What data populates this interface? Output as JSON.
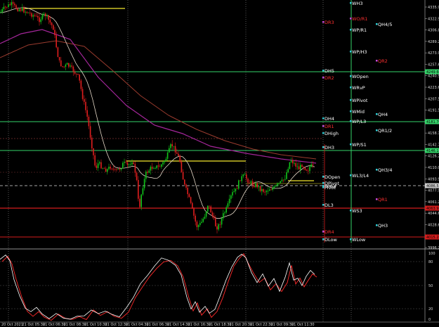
{
  "colors": {
    "background": "#000000",
    "bull_candle": "#11c51a",
    "bear_candle": "#e01e1e",
    "yellow_line": "#f2e52c",
    "green_line": "#35d46a",
    "red_line": "#d41c1c",
    "ma_white": "#e6d9c8",
    "ma_magenta": "#a4269a",
    "ma_brown": "#9a3b2e",
    "osc_white": "#ffffff",
    "osc_red": "#ff2a2a"
  },
  "price_axis": {
    "ticks": [
      "4335.95",
      "4322.90",
      "4306.85",
      "4289.20",
      "4273.90",
      "4257.60",
      "4240.95",
      "4223.60",
      "4207.55",
      "4191.55",
      "4175.50",
      "4158.70",
      "4142.70",
      "4126.20",
      "4110.00",
      "4093.95",
      "4077.95",
      "4061.25",
      "4044.60",
      "4028.65",
      "4012.30",
      "3996.25"
    ],
    "current_tags": [
      "4249.60",
      "4181.70",
      "4146.15",
      "4086.55",
      "4063.95",
      "4015.25"
    ]
  },
  "osc_axis": {
    "ticks": [
      "100",
      "80",
      "50",
      "20",
      "0"
    ]
  },
  "time_axis": {
    "labels": [
      "20 Oct 2021",
      "21 Oct 05:30",
      "21 Oct 06:30",
      "21 Oct 08:30",
      "21 Oct 10:30",
      "21 Oct 12:30",
      "21 Oct 04:30",
      "21 Oct 06:30",
      "21 Oct 14:30",
      "21 Oct 16:30",
      "21 Oct 18:30",
      "21 Oct 20:30",
      "21 Oct 22:30",
      "21 Oct 09:30",
      "21 Oct 11:30"
    ]
  },
  "levels_col1": [
    {
      "text": "DR3",
      "color": "#ff3030"
    },
    {
      "text": "DH5",
      "color": "#ffffff"
    },
    {
      "text": "DR2",
      "color": "#ff3030"
    },
    {
      "text": "DH4",
      "color": "#ffffff"
    },
    {
      "text": "DR1",
      "color": "#ff3030"
    },
    {
      "text": "DHigh",
      "color": "#ffffff"
    },
    {
      "text": "DH3",
      "color": "#ffffff"
    },
    {
      "text": "DOpen",
      "color": "#ffffff"
    },
    {
      "text": "DPivot",
      "color": "#ffffff"
    },
    {
      "text": "DMid",
      "color": "#ffffff"
    },
    {
      "text": "DL3",
      "color": "#ffffff"
    },
    {
      "text": "DR4",
      "color": "#ff3030"
    },
    {
      "text": "DLow",
      "color": "#ffffff"
    },
    {
      "text": "Pivot",
      "color": "#ffffff"
    }
  ],
  "levels_col2": [
    {
      "text": "WH3",
      "color": "#ffffff"
    },
    {
      "text": "WO/R1",
      "color": "#ff3030"
    },
    {
      "text": "WP/R1",
      "color": "#ffffff"
    },
    {
      "text": "WP/H3",
      "color": "#ffffff"
    },
    {
      "text": "WOpen",
      "color": "#ffffff"
    },
    {
      "text": "WRvP",
      "color": "#ffffff"
    },
    {
      "text": "WPivot",
      "color": "#ffffff"
    },
    {
      "text": "WMid",
      "color": "#ffffff"
    },
    {
      "text": "WP/L3",
      "color": "#ffffff"
    },
    {
      "text": "WP/S1",
      "color": "#ffffff"
    },
    {
      "text": "WL3/L4",
      "color": "#ffffff"
    },
    {
      "text": "WS3",
      "color": "#ffffff"
    },
    {
      "text": "WLow",
      "color": "#ffffff"
    }
  ],
  "levels_col3": [
    {
      "text": "QH4/5",
      "color": "#ffffff"
    },
    {
      "text": "QR2",
      "color": "#ff3030"
    },
    {
      "text": "QH4",
      "color": "#ffffff"
    },
    {
      "text": "QR1/2",
      "color": "#ffffff"
    },
    {
      "text": "QH3/4",
      "color": "#ffffff"
    },
    {
      "text": "QR1",
      "color": "#ff3030"
    },
    {
      "text": "QH3",
      "color": "#ffffff"
    }
  ]
}
